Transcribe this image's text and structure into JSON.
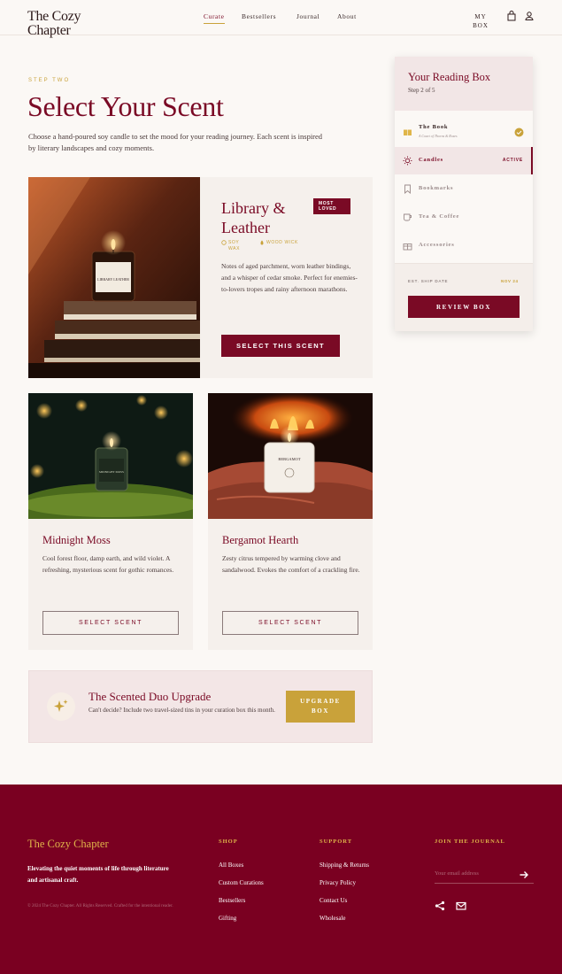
{
  "header": {
    "logo": "The Cozy Chapter",
    "nav": [
      {
        "label": "Curate",
        "active": true
      },
      {
        "label": "Bestsellers",
        "active": false
      },
      {
        "label": "Journal",
        "active": false
      },
      {
        "label": "About",
        "active": false
      }
    ],
    "my_box": "MY BOX",
    "icons": [
      "bag-icon",
      "user-icon"
    ]
  },
  "hero": {
    "step": "STEP TWO",
    "title": "Select Your Scent",
    "intro": "Choose a hand-poured soy candle to set the mood for your reading journey. Each scent is inspired by literary landscapes and cozy moments."
  },
  "featured": {
    "name": "Library & Leather",
    "badge": "MOST LOVED",
    "tags": [
      "SOY WAX",
      "WOOD WICK"
    ],
    "description": "Notes of aged parchment, worn leather bindings, and a whisper of cedar smoke. Perfect for enemies-to-lovers tropes and rainy afternoon marathons.",
    "button": "SELECT THIS SCENT",
    "jar_label": "LIBRARY LEATHER"
  },
  "cards": [
    {
      "name": "Midnight Moss",
      "description": "Cool forest floor, damp earth, and wild violet. A refreshing, mysterious scent for gothic romances.",
      "button": "SELECT SCENT",
      "jar_label": "MIDNIGHT MOSS"
    },
    {
      "name": "Bergamot Hearth",
      "description": "Zesty citrus tempered by warming clove and sandalwood. Evokes the comfort of a crackling fire.",
      "button": "SELECT SCENT",
      "jar_label": "BERGAMOT"
    }
  ],
  "upgrade": {
    "title": "The Scented Duo Upgrade",
    "description": "Can't decide? Include two travel-sized tins in your curation box this month.",
    "button": "UPGRADE BOX"
  },
  "sidebar": {
    "title": "Your Reading Box",
    "step": "Step 2 of 5",
    "items": [
      {
        "label": "The Book",
        "sub": "A Court of Thorns & Roses",
        "status": "done",
        "icon": "book-icon"
      },
      {
        "label": "Candles",
        "sub": "",
        "status": "ACTIVE",
        "icon": "sun-icon"
      },
      {
        "label": "Bookmarks",
        "sub": "",
        "status": "",
        "icon": "bookmark-icon"
      },
      {
        "label": "Tea & Coffee",
        "sub": "",
        "status": "",
        "icon": "cup-icon"
      },
      {
        "label": "Accessories",
        "sub": "",
        "status": "",
        "icon": "gift-icon"
      }
    ],
    "ship_label": "EST. SHIP DATE",
    "ship_date": "NOV 24",
    "button": "REVIEW BOX"
  },
  "footer": {
    "brand": "The Cozy Chapter",
    "tagline": "Elevating the quiet moments of life through literature and artisanal craft.",
    "copyright": "© 2024 The Cozy Chapter. All Rights Reserved. Crafted for the intentional reader.",
    "shop": {
      "heading": "SHOP",
      "links": [
        "All Boxes",
        "Custom Curations",
        "Bestsellers",
        "Gifting"
      ]
    },
    "support": {
      "heading": "SUPPORT",
      "links": [
        "Shipping & Returns",
        "Privacy Policy",
        "Contact Us",
        "Wholesale"
      ]
    },
    "journal": {
      "heading": "JOIN THE JOURNAL",
      "placeholder": "Your email address"
    }
  },
  "colors": {
    "accent": "#7a0a25",
    "gold": "#c9a23a",
    "footer": "#7a0021",
    "background": "#fbf8f5"
  }
}
